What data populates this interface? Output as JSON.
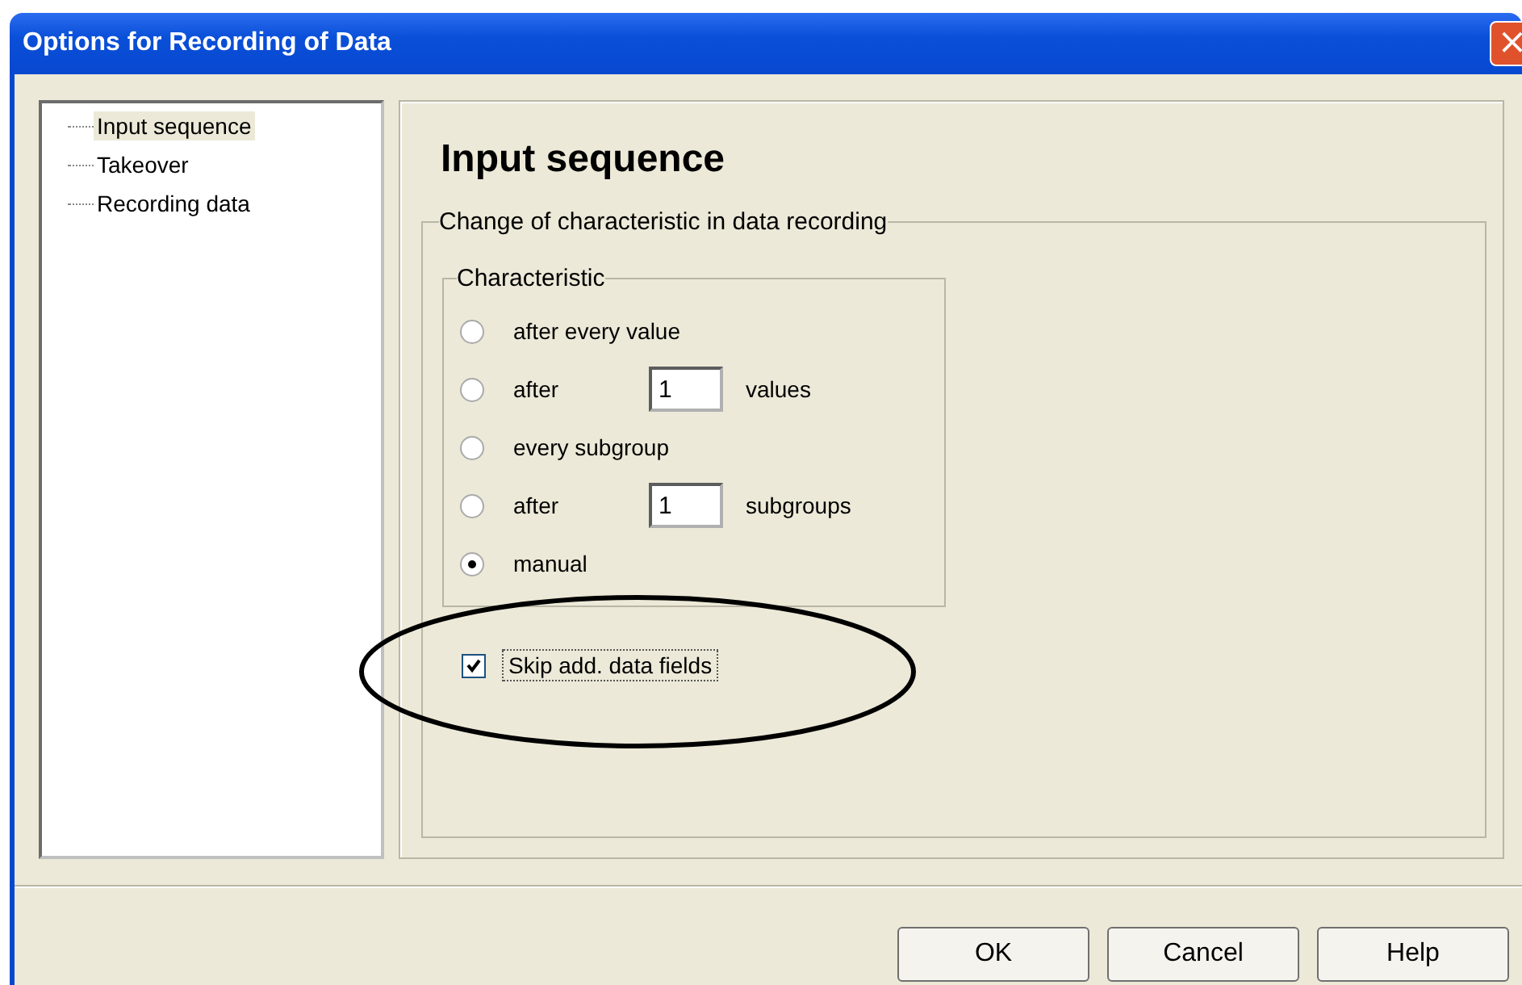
{
  "window": {
    "title": "Options for Recording of Data",
    "close_icon": "×"
  },
  "tree": {
    "items": [
      {
        "label": "Input sequence",
        "selected": true
      },
      {
        "label": "Takeover",
        "selected": false
      },
      {
        "label": "Recording data",
        "selected": false
      }
    ]
  },
  "page": {
    "heading": "Input sequence",
    "group": {
      "title": "Change of characteristic in data recording",
      "characteristic": {
        "title": "Characteristic",
        "options": [
          {
            "kind": "plain",
            "label": "after every value",
            "selected": false
          },
          {
            "kind": "count",
            "label": "after",
            "value": "1",
            "suffix": "values",
            "selected": false
          },
          {
            "kind": "plain",
            "label": "every subgroup",
            "selected": false
          },
          {
            "kind": "count",
            "label": "after",
            "value": "1",
            "suffix": "subgroups",
            "selected": false
          },
          {
            "kind": "plain",
            "label": "manual",
            "selected": true
          }
        ]
      },
      "skip": {
        "label": "Skip add. data fields",
        "checked": true
      }
    }
  },
  "buttons": [
    "OK",
    "Cancel",
    "Help"
  ]
}
